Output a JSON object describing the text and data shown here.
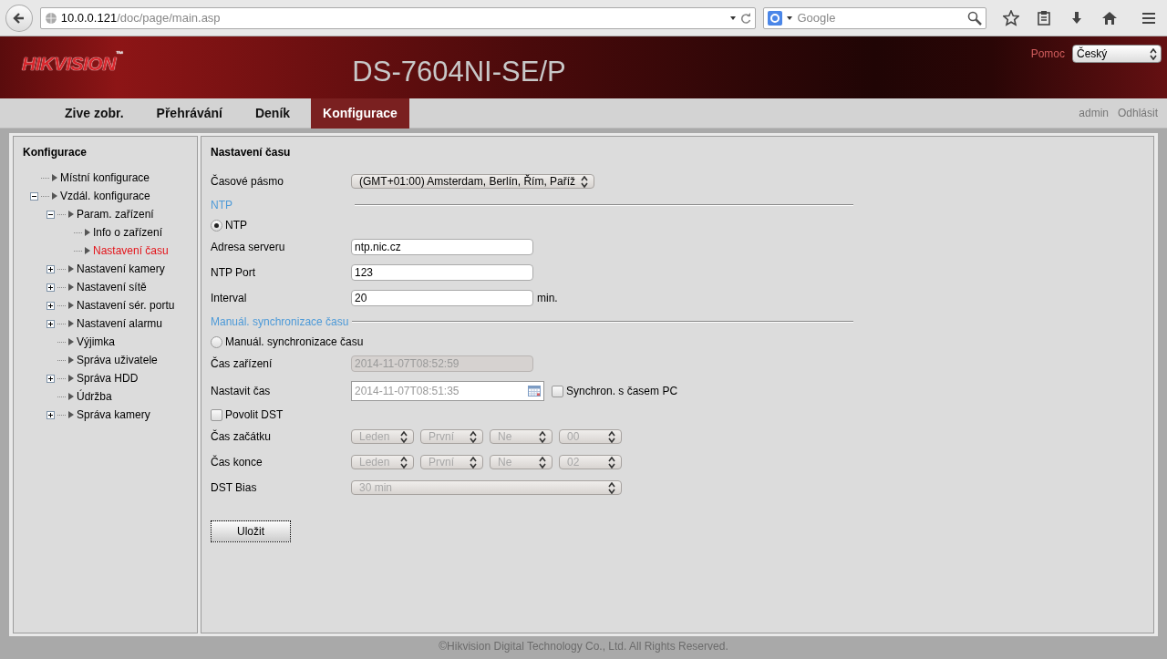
{
  "browser": {
    "url_host": "10.0.0.121",
    "url_path": "/doc/page/main.asp",
    "search_placeholder": "Google"
  },
  "header": {
    "logo": "HIKVISION",
    "logo_mark": "™",
    "model": "DS-7604NI-SE/P",
    "help": "Pomoc",
    "language": "Český"
  },
  "tabs": [
    {
      "label": "Zive zobr.",
      "selected": false
    },
    {
      "label": "Přehrávání",
      "selected": false
    },
    {
      "label": "Deník",
      "selected": false
    },
    {
      "label": "Konfigurace",
      "selected": true
    }
  ],
  "user_links": [
    "admin",
    "Odhlásit"
  ],
  "sidebar": {
    "title": "Konfigurace",
    "items": [
      {
        "label": "Místní konfigurace",
        "selected": false
      },
      {
        "label": "Vzdál. konfigurace",
        "selected": false,
        "expanded": true,
        "children": [
          {
            "label": "Param. zařízení",
            "selected": false,
            "expanded": true,
            "children": [
              {
                "label": "Info o zařízení",
                "selected": false
              },
              {
                "label": "Nastavení času",
                "selected": true
              }
            ]
          },
          {
            "label": "Nastavení kamery",
            "selected": false,
            "expanded": false
          },
          {
            "label": "Nastavení sítě",
            "selected": false,
            "expanded": false
          },
          {
            "label": "Nastavení sér. portu",
            "selected": false,
            "expanded": false
          },
          {
            "label": "Nastavení alarmu",
            "selected": false,
            "expanded": false
          },
          {
            "label": "Výjimka",
            "selected": false
          },
          {
            "label": "Správa uživatele",
            "selected": false
          },
          {
            "label": "Správa HDD",
            "selected": false,
            "expanded": false
          },
          {
            "label": "Údržba",
            "selected": false
          },
          {
            "label": "Správa kamery",
            "selected": false,
            "expanded": false
          }
        ]
      }
    ]
  },
  "content": {
    "title": "Nastavení času",
    "rows": [
      {
        "kind": "select",
        "label": "Časové pásmo",
        "value": "(GMT+01:00) Amsterdam, Berlín, Řím, Paříž",
        "disabled": false
      },
      {
        "kind": "section",
        "label": "NTP"
      },
      {
        "kind": "radio",
        "label": "NTP",
        "selected": true
      },
      {
        "kind": "text",
        "label": "Adresa serveru",
        "value": "ntp.nic.cz",
        "disabled": false
      },
      {
        "kind": "text",
        "label": "NTP Port",
        "value": "123",
        "disabled": false
      },
      {
        "kind": "text",
        "label": "Interval",
        "value": "20",
        "disabled": false,
        "unit": "min."
      },
      {
        "kind": "section",
        "label": "Manuál. synchronizace času"
      },
      {
        "kind": "radio",
        "label": "Manuál. synchronizace času",
        "selected": false
      },
      {
        "kind": "text",
        "label": "Čas zařízení",
        "value": "2014-11-07T08:52:59",
        "disabled": true
      },
      {
        "kind": "date",
        "label": "Nastavit čas",
        "value": "2014-11-07T08:51:35",
        "check_label": "Synchron. s časem PC",
        "checked": false
      },
      {
        "kind": "checkbox",
        "label": "Povolit DST",
        "checked": false
      },
      {
        "kind": "selects",
        "label": "Čas začátku",
        "values": [
          "Leden",
          "První",
          "Ne",
          "00"
        ],
        "disabled": true
      },
      {
        "kind": "selects",
        "label": "Čas konce",
        "values": [
          "Leden",
          "První",
          "Ne",
          "02"
        ],
        "disabled": true
      },
      {
        "kind": "wide_select",
        "label": "DST Bias",
        "value": "30 min",
        "disabled": true
      }
    ],
    "save": "Uložit"
  },
  "footer": "©Hikvision Digital Technology Co., Ltd. All Rights Reserved."
}
